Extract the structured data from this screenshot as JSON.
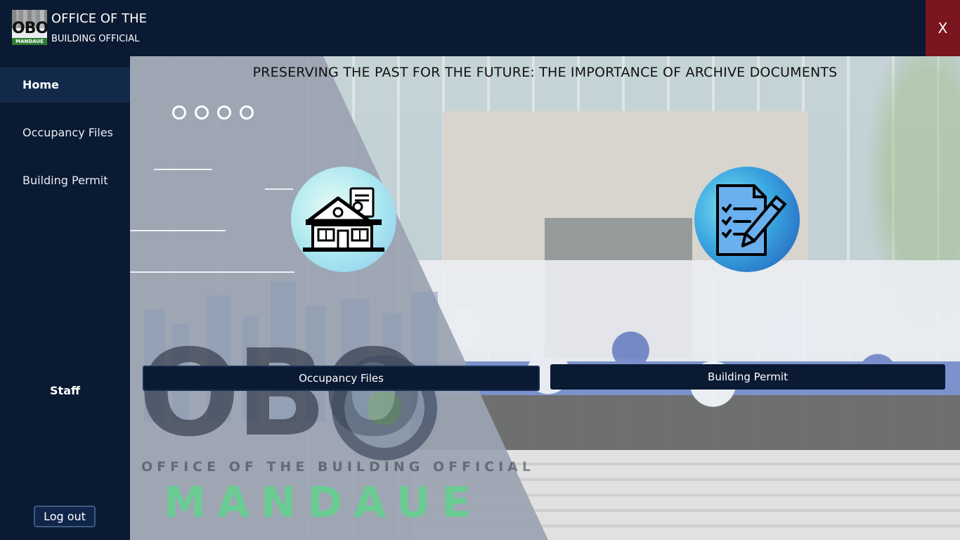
{
  "header": {
    "logo_text": "OBO",
    "logo_strip": "MANDAUE",
    "title_line1": "OFFICE OF THE",
    "title_line2": "BUILDING OFFICIAL",
    "close_label": "X"
  },
  "sidebar": {
    "items": [
      {
        "label": "Home",
        "active": true
      },
      {
        "label": "Occupancy Files",
        "active": false
      },
      {
        "label": "Building Permit",
        "active": false
      }
    ],
    "staff_label": "Staff",
    "logout_label": "Log out"
  },
  "main": {
    "heading": "PRESERVING THE PAST FOR THE FUTURE: THE IMPORTANCE OF ARCHIVE DOCUMENTS",
    "carousel_dots": 4,
    "background_logo": {
      "big": "OBO",
      "subtitle": "OFFICE OF THE BUILDING OFFICIAL",
      "city": "MANDAUE"
    },
    "icons": {
      "house": "house-certificate-icon",
      "permit": "permit-document-pen-icon"
    },
    "buttons": {
      "occupancy": "Occupancy Files",
      "permit": "Building Permit"
    }
  },
  "colors": {
    "navy": "#0b1a33",
    "close_red": "#7a1620",
    "active_nav": "#13294a",
    "mandaue_green": "#60d28c"
  }
}
